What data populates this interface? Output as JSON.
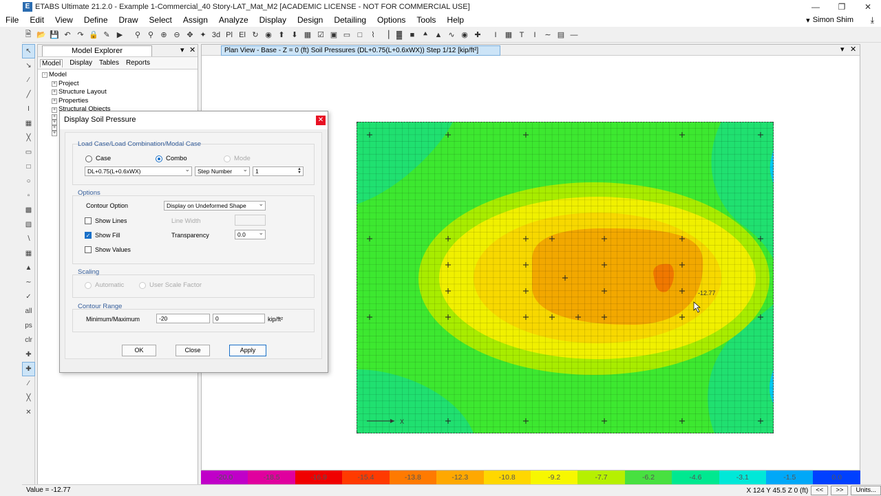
{
  "window": {
    "title": "ETABS Ultimate 21.2.0 - Example 1-Commercial_40 Story-LAT_Mat_M2  [ACADEMIC LICENSE - NOT FOR COMMERCIAL USE]",
    "app_letter": "E"
  },
  "menu": [
    "File",
    "Edit",
    "View",
    "Define",
    "Draw",
    "Select",
    "Assign",
    "Analyze",
    "Display",
    "Design",
    "Detailing",
    "Options",
    "Tools",
    "Help"
  ],
  "user": {
    "name": "Simon Shim"
  },
  "explorer": {
    "title": "Model Explorer",
    "tabs": [
      "Model",
      "Display",
      "Tables",
      "Reports"
    ],
    "tree": [
      "Model",
      "Project",
      "Structure Layout",
      "Properties",
      "Structural Objects"
    ]
  },
  "view": {
    "tab_title": "Plan View - Base - Z = 0 (ft)    Soil Pressures    (DL+0.75(L+0.6xWX))  Step 1/12  [kip/ft²]"
  },
  "plot": {
    "value_label": "-12.77",
    "axis_label": "X"
  },
  "dialog": {
    "title": "Display Soil Pressure",
    "group_load": "Load Case/Load Combination/Modal Case",
    "radio_case": "Case",
    "radio_combo": "Combo",
    "radio_mode": "Mode",
    "combo_value": "DL+0.75(L+0.6xWX)",
    "step_label": "Step Number",
    "step_value": "1",
    "group_options": "Options",
    "contour_option_label": "Contour Option",
    "contour_option_value": "Display on Undeformed Shape",
    "show_lines": "Show Lines",
    "show_fill": "Show Fill",
    "show_values": "Show Values",
    "line_width": "Line Width",
    "transparency_label": "Transparency",
    "transparency_value": "0.0",
    "group_scaling": "Scaling",
    "automatic": "Automatic",
    "user_scale": "User Scale Factor",
    "group_contour": "Contour Range",
    "minmax_label": "Minimum/Maximum",
    "min_value": "-20",
    "max_value": "0",
    "units": "kip/ft²",
    "ok": "OK",
    "close": "Close",
    "apply": "Apply"
  },
  "legend": {
    "labels": [
      "-20.0",
      "-18.5",
      "-16.9",
      "-15.4",
      "-13.8",
      "-12.3",
      "-10.8",
      "-9.2",
      "-7.7",
      "-6.2",
      "-4.6",
      "-3.1",
      "-1.5",
      "0.0"
    ],
    "colors": [
      "#c000c8",
      "#e0009e",
      "#f00000",
      "#ff3a00",
      "#ff7a00",
      "#ffa800",
      "#ffd700",
      "#f7f700",
      "#b6f000",
      "#48e040",
      "#00e890",
      "#00e8d8",
      "#00a8f8",
      "#0040ff"
    ]
  },
  "status": {
    "value": "Value = -12.77",
    "coords": "X 124  Y 45.5  Z 0 (ft)",
    "units_btn": "Units..."
  }
}
